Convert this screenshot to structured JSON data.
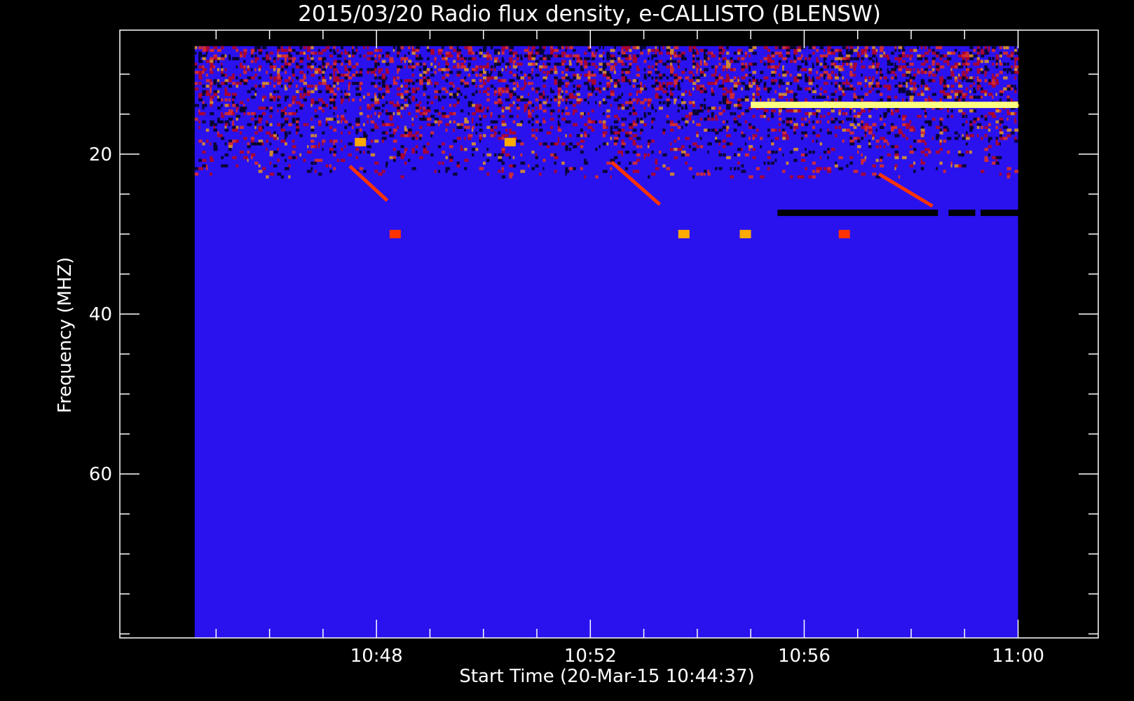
{
  "chart_data": {
    "type": "heatmap",
    "title": "2015/03/20  Radio flux density, e-CALLISTO (BLENSW)",
    "xlabel": "Start Time (20-Mar-15 10:44:37)",
    "ylabel": "Frequency (MHZ)",
    "x_ticks": [
      {
        "label": "10:48",
        "minutes": 48
      },
      {
        "label": "10:52",
        "minutes": 52
      },
      {
        "label": "10:56",
        "minutes": 56
      },
      {
        "label": "11:00",
        "minutes": 60
      }
    ],
    "x_minor_minutes": [
      45,
      46,
      47,
      49,
      50,
      51,
      53,
      54,
      55,
      57,
      58,
      59
    ],
    "y_ticks": [
      {
        "label": "20",
        "value": 20
      },
      {
        "label": "40",
        "value": 40
      },
      {
        "label": "60",
        "value": 60
      }
    ],
    "y_minor_values": [
      10,
      15,
      25,
      30,
      35,
      45,
      50,
      55,
      65,
      70,
      75,
      80
    ],
    "xlim_minutes": [
      44.6,
      60
    ],
    "axis_xlim_minutes": [
      43.2,
      61.5
    ],
    "ylim_mhz": [
      6.5,
      80.5
    ],
    "axis_ylim_mhz": [
      4.5,
      80.5
    ],
    "colormap": [
      "#000000",
      "#1200f0",
      "#3000ff",
      "#cc0000",
      "#ff3300",
      "#ffaa00",
      "#ffff80"
    ],
    "background_color": "#2a12ee",
    "features": [
      {
        "kind": "band",
        "t_start": 55.0,
        "t_end": 60.0,
        "f": 13.8,
        "level": 6,
        "description": "persistent interference line"
      },
      {
        "kind": "band",
        "t_start": 55.5,
        "t_end": 58.5,
        "f": 27.3,
        "level": 0
      },
      {
        "kind": "band",
        "t_start": 58.7,
        "t_end": 59.2,
        "f": 27.3,
        "level": 0
      },
      {
        "kind": "band",
        "t_start": 59.3,
        "t_end": 60.0,
        "f": 27.3,
        "level": 0
      },
      {
        "kind": "patch",
        "t": 54.9,
        "f": 30.0,
        "level": 5
      },
      {
        "kind": "patch",
        "t": 53.75,
        "f": 30.0,
        "level": 5
      },
      {
        "kind": "patch",
        "t": 56.75,
        "f": 30.0,
        "level": 4
      },
      {
        "kind": "patch",
        "t": 48.35,
        "f": 30.0,
        "level": 4
      },
      {
        "kind": "patch",
        "t": 47.7,
        "f": 18.5,
        "level": 5
      },
      {
        "kind": "patch",
        "t": 50.5,
        "f": 18.5,
        "level": 5
      },
      {
        "kind": "drift",
        "t_start": 47.5,
        "t_end": 48.2,
        "f_start": 21.5,
        "f_end": 25.8,
        "level": 4
      },
      {
        "kind": "drift",
        "t_start": 52.4,
        "t_end": 53.3,
        "f_start": 21.0,
        "f_end": 26.3,
        "level": 4
      },
      {
        "kind": "drift",
        "t_start": 57.4,
        "t_end": 58.4,
        "f_start": 22.5,
        "f_end": 26.5,
        "level": 4
      }
    ]
  }
}
